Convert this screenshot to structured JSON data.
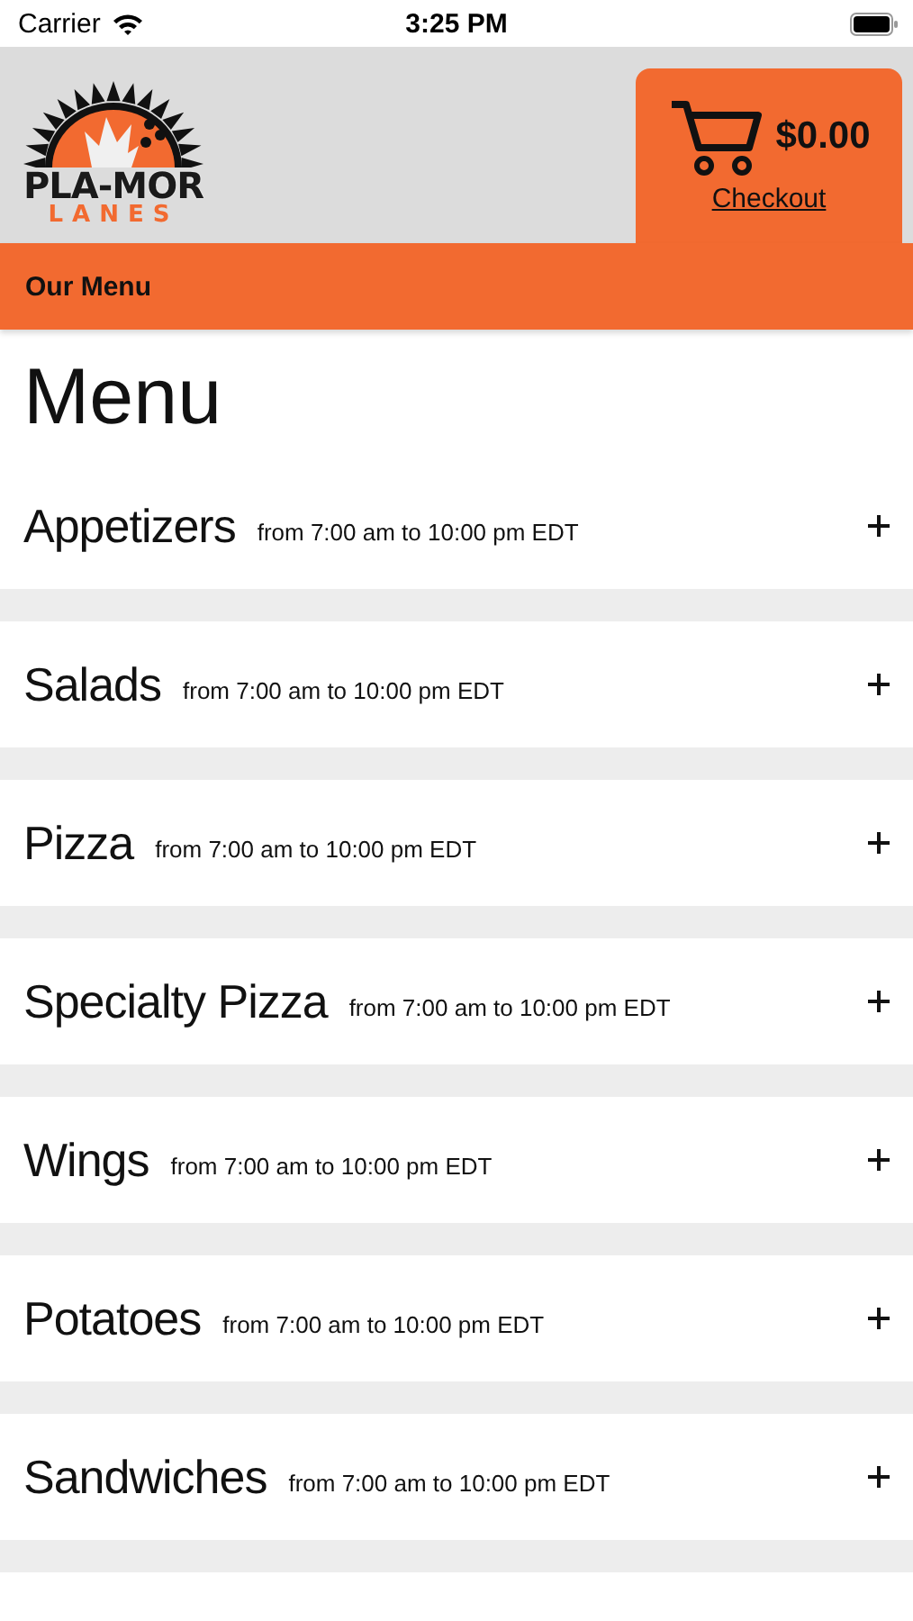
{
  "status_bar": {
    "carrier": "Carrier",
    "time": "3:25 PM"
  },
  "header": {
    "logo": {
      "top": "PLA-MOR",
      "bottom": "LANES"
    },
    "cart": {
      "total": "$0.00",
      "link": "Checkout"
    }
  },
  "nav": {
    "label": "Our Menu"
  },
  "title": "Menu",
  "categories": [
    {
      "name": "Appetizers",
      "hours": "from 7:00 am to 10:00 pm EDT",
      "expanded": false
    },
    {
      "name": "Salads",
      "hours": "from 7:00 am to 10:00 pm EDT",
      "expanded": false
    },
    {
      "name": "Pizza",
      "hours": "from 7:00 am to 10:00 pm EDT",
      "expanded": false
    },
    {
      "name": "Specialty Pizza",
      "hours": "from 7:00 am to 10:00 pm EDT",
      "expanded": false
    },
    {
      "name": "Wings",
      "hours": "from 7:00 am to 10:00 pm EDT",
      "expanded": false
    },
    {
      "name": "Potatoes",
      "hours": "from 7:00 am to 10:00 pm EDT",
      "expanded": false
    },
    {
      "name": "Sandwiches",
      "hours": "from 7:00 am to 10:00 pm EDT",
      "expanded": false
    }
  ]
}
